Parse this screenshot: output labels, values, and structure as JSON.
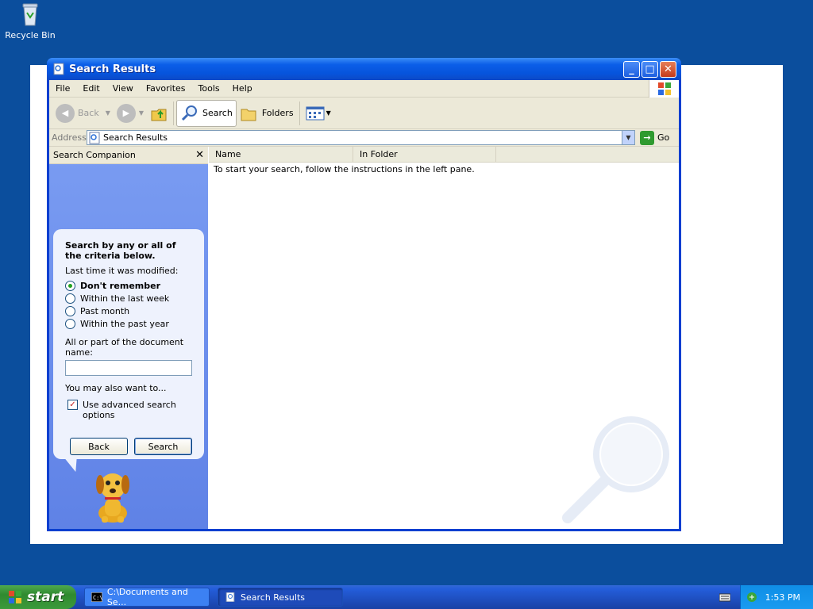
{
  "desktop": {
    "recycle_bin_label": "Recycle Bin"
  },
  "window": {
    "title": "Search Results",
    "menu": [
      "File",
      "Edit",
      "View",
      "Favorites",
      "Tools",
      "Help"
    ],
    "toolbar": {
      "back_label": "Back",
      "search_label": "Search",
      "folders_label": "Folders"
    },
    "address": {
      "label": "Address",
      "value": "Search Results",
      "go_label": "Go"
    },
    "companion": {
      "header": "Search Companion",
      "heading": "Search by any or all of the criteria below.",
      "modified_label": "Last time it was modified:",
      "options": [
        {
          "label": "Don't remember",
          "selected": true
        },
        {
          "label": "Within the last week",
          "selected": false
        },
        {
          "label": "Past month",
          "selected": false
        },
        {
          "label": "Within the past year",
          "selected": false
        }
      ],
      "name_label": "All or part of the document name:",
      "name_value": "",
      "also_label": "You may also want to...",
      "advanced_label": "Use advanced search options",
      "advanced_checked": true,
      "back_button": "Back",
      "search_button": "Search"
    },
    "results": {
      "columns": [
        "Name",
        "In Folder"
      ],
      "message": "To start your search, follow the instructions in the left pane."
    }
  },
  "taskbar": {
    "start_label": "start",
    "tasks": [
      {
        "label": "C:\\Documents and Se...",
        "active": false
      },
      {
        "label": "Search Results",
        "active": true
      }
    ],
    "clock": "1:53 PM"
  },
  "colors": {
    "desktop": "#0b4e9d",
    "titlebar": "#0654dc",
    "companion": "#6b8ef0",
    "start": "#3b9a3b"
  }
}
